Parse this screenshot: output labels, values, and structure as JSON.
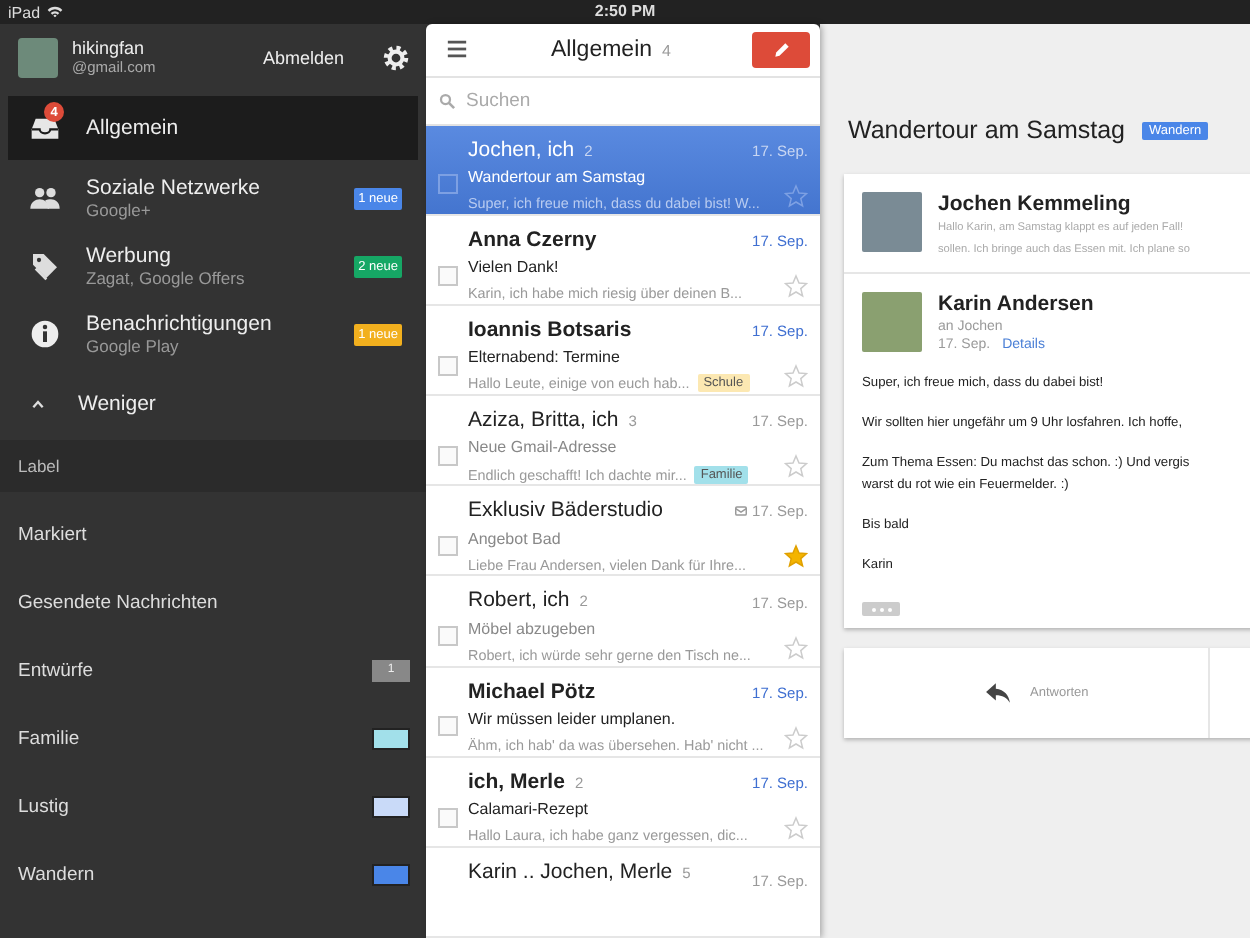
{
  "status_bar": {
    "device": "iPad",
    "time": "2:50 PM"
  },
  "account": {
    "name": "hikingfan",
    "email": "@gmail.com",
    "signout": "Abmelden"
  },
  "categories": [
    {
      "kind": "inbox",
      "label": "Allgemein",
      "badge": "4",
      "selected": true
    },
    {
      "kind": "people",
      "label": "Soziale Netzwerke",
      "sub": "Google+",
      "count": "1 neue",
      "color": "#4a86e8",
      "selected": false
    },
    {
      "kind": "tag",
      "label": "Werbung",
      "sub": "Zagat, Google Offers",
      "count": "2 neue",
      "color": "#16a765",
      "selected": false
    },
    {
      "kind": "info",
      "label": "Benachrichtigungen",
      "sub": "Google Play",
      "count": "1 neue",
      "color": "#f2b01e",
      "selected": false
    }
  ],
  "less_toggle": "Weniger",
  "labels_header": "Label",
  "labels": [
    {
      "label": "Markiert"
    },
    {
      "label": "Gesendete Nachrichten"
    },
    {
      "label": "Entwürfe",
      "count": "1"
    },
    {
      "label": "Familie",
      "color": "#a2e0ea"
    },
    {
      "label": "Lustig",
      "color": "#c9daf8"
    },
    {
      "label": "Wandern",
      "color": "#4a86e8"
    }
  ],
  "list": {
    "title": "Allgemein",
    "count": "4",
    "search": {
      "placeholder": "Suchen"
    },
    "threads": [
      {
        "sender": "Jochen, ich",
        "count": "2",
        "date": "17. Sep.",
        "subject": "Wandertour am Samstag",
        "snippet": "Super, ich freue mich, dass du dabei bist! W...",
        "unread": false,
        "selected": true,
        "starred": false,
        "attachment": false
      },
      {
        "sender": "Anna Czerny",
        "date": "17. Sep.",
        "subject": "Vielen Dank!",
        "snippet": "Karin, ich habe mich riesig über deinen B...",
        "unread": true,
        "selected": false,
        "starred": false,
        "attachment": false
      },
      {
        "sender": "Ioannis Botsaris",
        "date": "17. Sep.",
        "subject": "Elternabend: Termine",
        "snippet": "Hallo Leute, einige von euch hab...",
        "tag": {
          "text": "Schule",
          "color": "#fce8b2"
        },
        "unread": true,
        "selected": false,
        "starred": false,
        "attachment": false
      },
      {
        "sender": "Aziza, Britta, ich",
        "count": "3",
        "date": "17. Sep.",
        "subject": "Neue Gmail-Adresse",
        "snippet": "Endlich geschafft! Ich dachte mir...",
        "tag": {
          "text": "Familie",
          "color": "#a2e0ea"
        },
        "unread": false,
        "selected": false,
        "starred": false,
        "attachment": false
      },
      {
        "sender": "Exklusiv Bäderstudio",
        "date": "17. Sep.",
        "subject": "Angebot Bad",
        "snippet": "Liebe Frau Andersen, vielen Dank für Ihre...",
        "unread": false,
        "selected": false,
        "starred": true,
        "attachment": true
      },
      {
        "sender": "Robert, ich",
        "count": "2",
        "date": "17. Sep.",
        "subject": "Möbel abzugeben",
        "snippet": "Robert, ich würde sehr gerne den Tisch ne...",
        "unread": false,
        "selected": false,
        "starred": false,
        "attachment": false
      },
      {
        "sender": "Michael Pötz",
        "date": "17. Sep.",
        "subject": "Wir müssen leider umplanen.",
        "snippet": "Ähm, ich hab' da was übersehen. Hab' nicht ...",
        "unread": true,
        "selected": false,
        "starred": false,
        "attachment": false
      },
      {
        "sender": "ich, Merle",
        "count": "2",
        "date": "17. Sep.",
        "subject": "Calamari-Rezept",
        "snippet": "Hallo Laura, ich habe ganz vergessen, dic...",
        "unread": true,
        "selected": false,
        "starred": false,
        "attachment": false
      },
      {
        "sender": "Karin .. Jochen, Merle",
        "count": "5",
        "date": "17. Sep.",
        "unread": false,
        "selected": false
      }
    ]
  },
  "conversation": {
    "subject": "Wandertour am Samstag",
    "label": {
      "text": "Wandern",
      "color": "#4a86e8"
    },
    "messages": [
      {
        "sender": "Jochen Kemmeling",
        "expanded": false,
        "snippet": [
          "Hallo Karin, am Samstag klappt es auf jeden Fall!",
          "sollen. Ich bringe auch das Essen mit. Ich plane so"
        ]
      },
      {
        "sender": "Karin Andersen",
        "expanded": true,
        "to": "an Jochen",
        "date": "17. Sep.",
        "details": "Details",
        "body": [
          [
            "Super, ich freue mich, dass du dabei bist!"
          ],
          [
            "Wir sollten hier ungefähr um 9 Uhr losfahren. Ich hoffe,"
          ],
          [
            "Zum Thema Essen: Du machst das schon. :) Und vergis",
            "warst du rot wie ein Feuermelder. :)"
          ],
          [
            "Bis bald"
          ],
          [
            "Karin"
          ]
        ]
      }
    ],
    "reply": "Antworten"
  }
}
